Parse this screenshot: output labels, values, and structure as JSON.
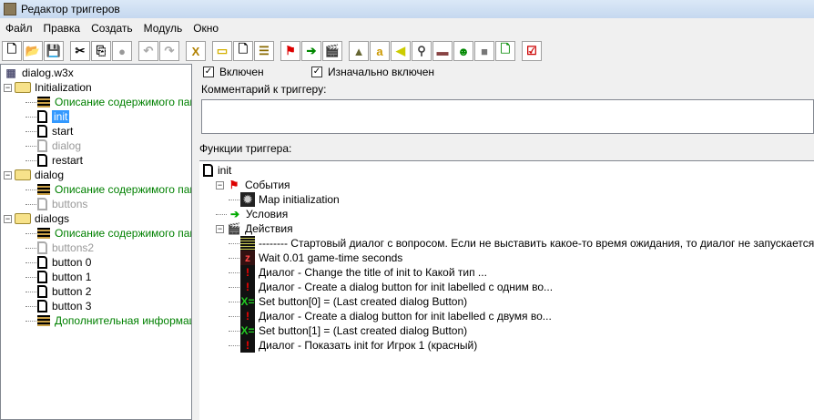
{
  "window": {
    "title": "Редактор триггеров"
  },
  "menu": [
    "Файл",
    "Правка",
    "Создать",
    "Модуль",
    "Окно"
  ],
  "toolbar": [
    {
      "name": "new-icon",
      "glyph": "🗋",
      "color": "#000"
    },
    {
      "name": "open-icon",
      "glyph": "📂",
      "color": "#c90"
    },
    {
      "name": "save-icon",
      "glyph": "💾",
      "color": "#000"
    },
    {
      "gap": true
    },
    {
      "name": "cut-icon",
      "glyph": "✂",
      "color": "#000"
    },
    {
      "name": "copy-icon",
      "glyph": "⎘",
      "color": "#000"
    },
    {
      "name": "paste-icon",
      "glyph": "●",
      "color": "#999"
    },
    {
      "gap": true
    },
    {
      "name": "undo-icon",
      "glyph": "↶",
      "color": "#aaa"
    },
    {
      "name": "redo-icon",
      "glyph": "↷",
      "color": "#aaa"
    },
    {
      "gap": true
    },
    {
      "name": "variables-icon",
      "glyph": "X",
      "color": "#b08000"
    },
    {
      "gap": true
    },
    {
      "name": "new-category-icon",
      "glyph": "▭",
      "color": "#d4b000"
    },
    {
      "name": "new-trigger-icon",
      "glyph": "🗋",
      "color": "#000"
    },
    {
      "name": "new-comment-icon",
      "glyph": "☰",
      "color": "#8a6a00"
    },
    {
      "gap": true
    },
    {
      "name": "new-event-icon",
      "glyph": "⚑",
      "color": "#d00"
    },
    {
      "name": "new-condition-icon",
      "glyph": "➔",
      "color": "#080"
    },
    {
      "name": "new-action-icon",
      "glyph": "🎬",
      "color": "#000"
    },
    {
      "gap": true
    },
    {
      "name": "terrain-editor-icon",
      "glyph": "▲",
      "color": "#663"
    },
    {
      "name": "trigger-editor-icon",
      "glyph": "a",
      "color": "#c90"
    },
    {
      "name": "sound-editor-icon",
      "glyph": "◀",
      "color": "#cc0"
    },
    {
      "name": "object-editor-icon",
      "glyph": "⚲",
      "color": "#444"
    },
    {
      "name": "campaign-editor-icon",
      "glyph": "▬",
      "color": "#844"
    },
    {
      "name": "ai-editor-icon",
      "glyph": "☻",
      "color": "#080"
    },
    {
      "name": "object-manager-icon",
      "glyph": "■",
      "color": "#777"
    },
    {
      "name": "import-manager-icon",
      "glyph": "🗋",
      "color": "#080"
    },
    {
      "gap": true
    },
    {
      "name": "test-map-icon",
      "glyph": "☑",
      "color": "#c00"
    }
  ],
  "tree": [
    {
      "label": "dialog.w3x",
      "type": "map",
      "level": 0
    },
    {
      "label": "Initialization",
      "type": "folder",
      "level": 0
    },
    {
      "label": "Описание содержимого папки",
      "type": "comment",
      "level": 1
    },
    {
      "label": "init",
      "type": "trigger",
      "level": 1,
      "selected": true
    },
    {
      "label": "start",
      "type": "trigger",
      "level": 1
    },
    {
      "label": "dialog",
      "type": "disabled",
      "level": 1
    },
    {
      "label": "restart",
      "type": "trigger",
      "level": 1
    },
    {
      "label": "dialog",
      "type": "folder",
      "level": 0
    },
    {
      "label": "Описание содержимого папки",
      "type": "comment",
      "level": 1
    },
    {
      "label": "buttons",
      "type": "disabled",
      "level": 1
    },
    {
      "label": "dialogs",
      "type": "folder",
      "level": 0
    },
    {
      "label": "Описание содержимого папки",
      "type": "comment",
      "level": 1
    },
    {
      "label": "buttons2",
      "type": "disabled",
      "level": 1
    },
    {
      "label": "button 0",
      "type": "trigger",
      "level": 1
    },
    {
      "label": "button 1",
      "type": "trigger",
      "level": 1
    },
    {
      "label": "button 2",
      "type": "trigger",
      "level": 1
    },
    {
      "label": "button 3",
      "type": "trigger",
      "level": 1
    },
    {
      "label": "Дополнительная информация",
      "type": "comment",
      "level": 1
    }
  ],
  "editor": {
    "enabled_label": "Включен",
    "initially_on_label": "Изначально включен",
    "comment_label": "Комментарий к триггеру:",
    "functions_label": "Функции триггера:",
    "functions": [
      {
        "label": "init",
        "type": "trigger",
        "level": 0
      },
      {
        "label": "События",
        "type": "events",
        "level": 1
      },
      {
        "label": "Map initialization",
        "type": "gear",
        "level": 2
      },
      {
        "label": "Условия",
        "type": "conditions",
        "level": 1
      },
      {
        "label": "Действия",
        "type": "actions",
        "level": 1
      },
      {
        "label": "-------- Стартовый диалог с вопросом. Если не выставить какое-то время ожидания, то диалог не запускается. --------",
        "type": "comment",
        "level": 2
      },
      {
        "label": "Wait 0.01 game-time seconds",
        "type": "wait",
        "level": 2
      },
      {
        "label": "Диалог - Change the title of init to Какой тип ...",
        "type": "alert",
        "level": 2
      },
      {
        "label": "Диалог - Create a dialog button for init labelled с одним во...",
        "type": "alert",
        "level": 2
      },
      {
        "label": "Set button[0] = (Last created dialog Button)",
        "type": "set",
        "level": 2
      },
      {
        "label": "Диалог - Create a dialog button for init labelled с двумя во...",
        "type": "alert",
        "level": 2
      },
      {
        "label": "Set button[1] = (Last created dialog Button)",
        "type": "set",
        "level": 2
      },
      {
        "label": "Диалог - Показать init for Игрок 1 (красный)",
        "type": "alert",
        "level": 2
      }
    ]
  }
}
